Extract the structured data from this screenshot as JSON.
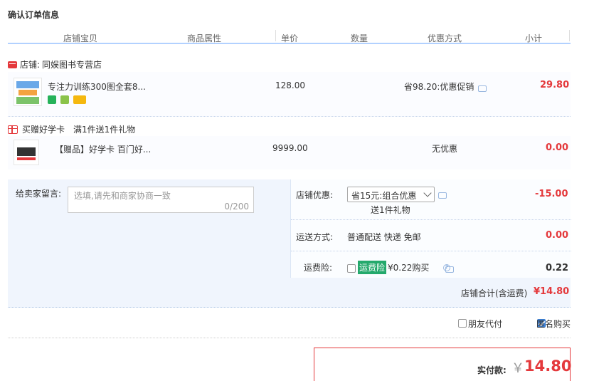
{
  "page": {
    "title": "确认订单信息"
  },
  "columns": [
    "店铺宝贝",
    "商品属性",
    "单价",
    "数量",
    "优惠方式",
    "小计"
  ],
  "shop": {
    "label": "店铺:",
    "name": "同娱图书专营店"
  },
  "items": [
    {
      "title": "专注力训练300图全套8...",
      "price": "128.00",
      "discount": "省98.20:优惠促销",
      "subtotal": "29.80"
    },
    {
      "title": "【赠品】好学卡 百门好...",
      "price": "9999.00",
      "discount": "无优惠",
      "subtotal": "0.00"
    }
  ],
  "gift_promo": {
    "name": "买赠好学卡",
    "rule": "满1件送1件礼物"
  },
  "memo": {
    "label": "给卖家留言:",
    "placeholder": "选填,请先和商家协商一致",
    "counter": "0/200"
  },
  "shop_discount": {
    "label": "店铺优惠:",
    "selected": "省15元:组合优惠",
    "note": "送1件礼物",
    "amount": "-15.00"
  },
  "shipping": {
    "label": "运送方式:",
    "method": "普通配送 快递 免邮",
    "amount": "0.00"
  },
  "insurance": {
    "label": "运费险:",
    "tag": "运费险",
    "text": "¥0.22购买",
    "amount": "0.22"
  },
  "shop_total": {
    "label": "店铺合计(含运费)",
    "amount": "¥14.80"
  },
  "options": {
    "friend_pay": "朋友代付",
    "anonymous": "匿名购买"
  },
  "payment": {
    "label": "实付款:",
    "currency": "￥",
    "amount": "14.80"
  },
  "colors": {
    "accent": "#e4393c",
    "header_line": "#b2d1ff",
    "panel_bg": "#f0f5fd"
  }
}
